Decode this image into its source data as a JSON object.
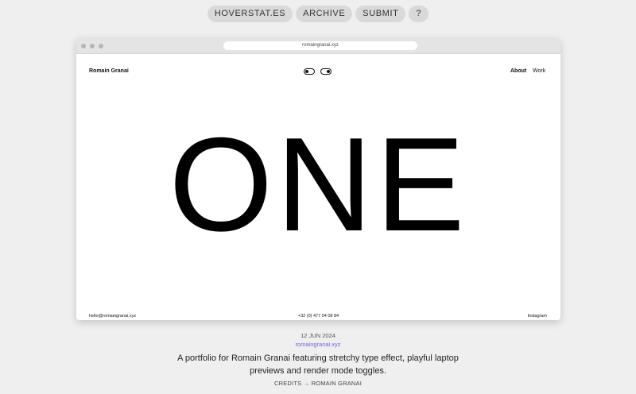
{
  "topnav": {
    "items": [
      {
        "label": "HOVERSTAT.ES"
      },
      {
        "label": "ARCHIVE"
      },
      {
        "label": "SUBMIT"
      },
      {
        "label": "?"
      }
    ]
  },
  "browser": {
    "url": "romaingranai.xyz",
    "site": {
      "name": "Romain Granai",
      "nav": {
        "about": "About",
        "work": "Work"
      },
      "hero_text": "ONE",
      "footer": {
        "email": "hello@romaingranai.xyz",
        "phone": "+32 (0) 477 04 08 84",
        "social": "Instagram"
      }
    }
  },
  "entry": {
    "date": "12 JUN 2024",
    "link": "romaingranai.xyz",
    "description": "A portfolio for Romain Granai featuring stretchy type effect, playful laptop previews and render mode toggles.",
    "credits": "CREDITS → ROMAIN GRANAI"
  },
  "colors": {
    "background": "#efefef",
    "pill": "#d9d9d9",
    "link": "#7a5ad8"
  }
}
